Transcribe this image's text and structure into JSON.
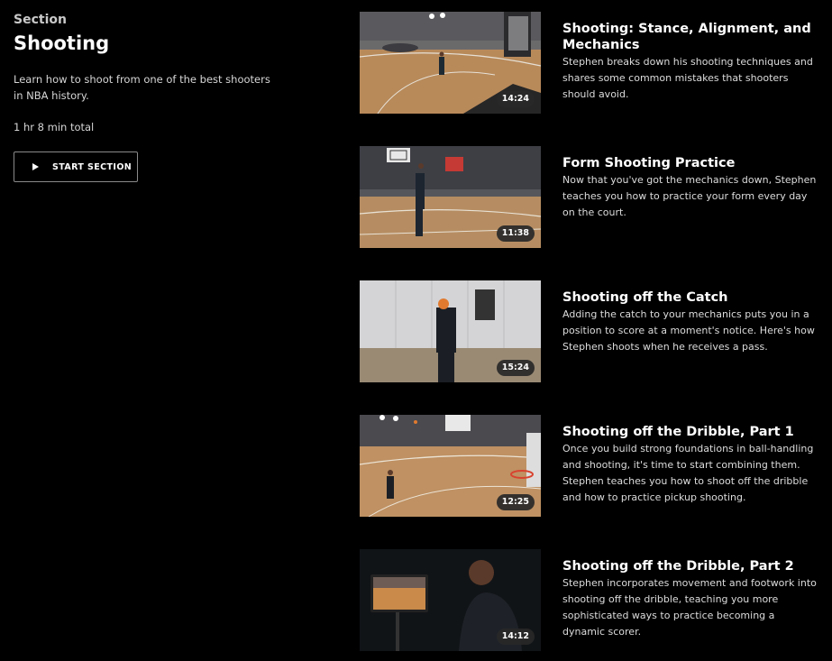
{
  "section": {
    "eyebrow": "Section",
    "title": "Shooting",
    "description": "Learn how to shoot from one of the best shooters in NBA history.",
    "total": "1 hr 8 min total",
    "start_label": "START SECTION"
  },
  "lessons": [
    {
      "title": "Shooting: Stance, Alignment, and Mechanics",
      "description": "Stephen breaks down his shooting techniques and shares some common mistakes that shooters should avoid.",
      "duration": "14:24"
    },
    {
      "title": "Form Shooting Practice",
      "description": "Now that you've got the mechanics down, Stephen teaches you how to practice your form every day on the court.",
      "duration": "11:38"
    },
    {
      "title": "Shooting off the Catch",
      "description": "Adding the catch to your mechanics puts you in a position to score at a moment's notice. Here's how Stephen shoots when he receives a pass.",
      "duration": "15:24"
    },
    {
      "title": "Shooting off the Dribble, Part 1",
      "description": "Once you build strong foundations in ball-handling and shooting, it's time to start combining them. Stephen teaches you how to shoot off the dribble and how to practice pickup shooting.",
      "duration": "12:25"
    },
    {
      "title": "Shooting off the Dribble, Part 2",
      "description": "Stephen incorporates movement and footwork into shooting off the dribble, teaching you more sophisticated ways to practice becoming a dynamic scorer.",
      "duration": "14:12"
    }
  ]
}
